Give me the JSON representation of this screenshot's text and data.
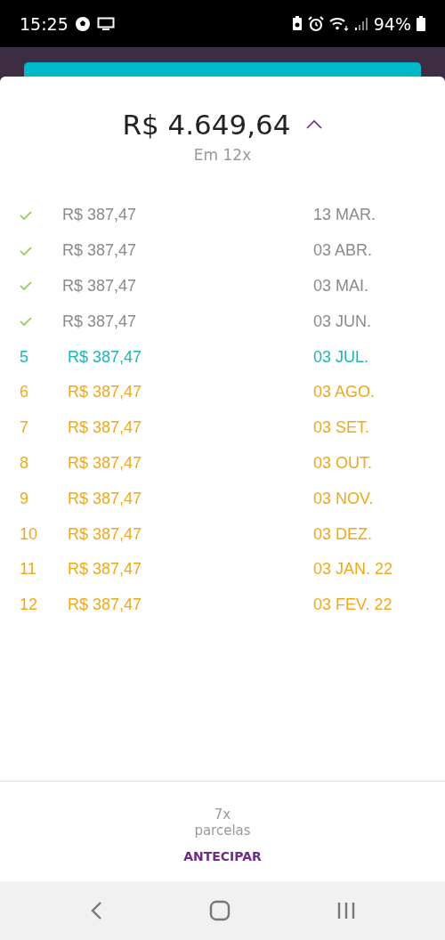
{
  "status_bar": {
    "time": "15:25",
    "battery": "94%"
  },
  "summary": {
    "total": "R$ 4.649,64",
    "expanded": true,
    "subtitle": "Em 12x"
  },
  "installments": [
    {
      "kind": "paid",
      "amount": "R$ 387,47",
      "due": "13 MAR."
    },
    {
      "kind": "paid",
      "amount": "R$ 387,47",
      "due": "03 ABR."
    },
    {
      "kind": "paid",
      "amount": "R$ 387,47",
      "due": "03 MAI."
    },
    {
      "kind": "paid",
      "amount": "R$ 387,47",
      "due": "03 JUN."
    },
    {
      "kind": "current",
      "number": "5",
      "amount": "R$ 387,47",
      "due": "03 JUL."
    },
    {
      "kind": "future",
      "number": "6",
      "amount": "R$ 387,47",
      "due": "03 AGO."
    },
    {
      "kind": "future",
      "number": "7",
      "amount": "R$ 387,47",
      "due": "03 SET."
    },
    {
      "kind": "future",
      "number": "8",
      "amount": "R$ 387,47",
      "due": "03 OUT."
    },
    {
      "kind": "future",
      "number": "9",
      "amount": "R$ 387,47",
      "due": "03 NOV."
    },
    {
      "kind": "future",
      "number": "10",
      "amount": "R$ 387,47",
      "due": "03 DEZ."
    },
    {
      "kind": "future",
      "number": "11",
      "amount": "R$ 387,47",
      "due": "03 JAN. 22"
    },
    {
      "kind": "future",
      "number": "12",
      "amount": "R$ 387,47",
      "due": "03 FEV. 22"
    }
  ],
  "footer": {
    "count": "7x",
    "count_label": "parcelas",
    "action": "ANTECIPAR"
  }
}
